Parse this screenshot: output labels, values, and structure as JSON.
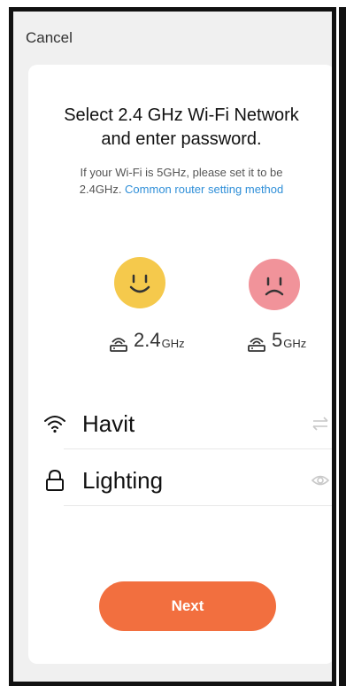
{
  "header": {
    "cancel_label": "Cancel"
  },
  "title": "Select 2.4 GHz Wi-Fi Network\nand enter password.",
  "subtitle": {
    "line1": "If your Wi-Fi is 5GHz, please set it to be",
    "line2_prefix": "2.4GHz. ",
    "link": "Common router setting method"
  },
  "bands": [
    {
      "value": "2.4",
      "unit": "GHz",
      "face": "happy",
      "color": "#f5c94c"
    },
    {
      "value": "5",
      "unit": "GHz",
      "face": "sad",
      "color": "#f1939a"
    }
  ],
  "network": {
    "ssid": "Havit",
    "password": "Lighting"
  },
  "next_label": "Next",
  "colors": {
    "accent": "#f26f3f",
    "link": "#2f8fd8"
  }
}
